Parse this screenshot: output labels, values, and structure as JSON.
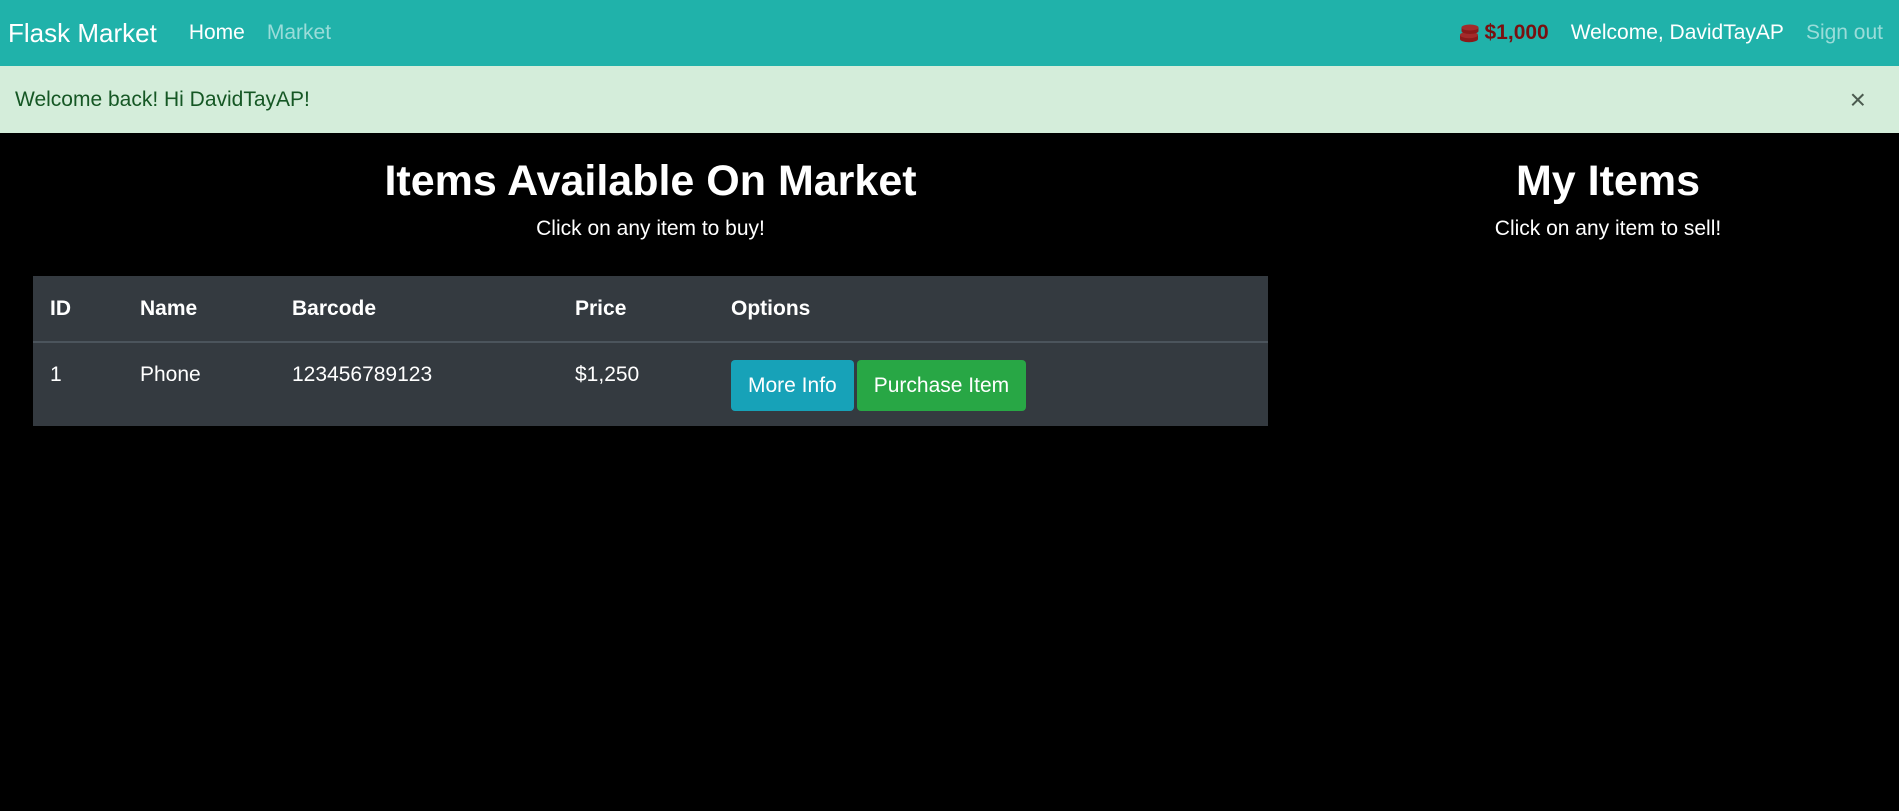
{
  "navbar": {
    "brand": "Flask Market",
    "links": [
      {
        "label": "Home"
      },
      {
        "label": "Market"
      }
    ],
    "budget": "$1,000",
    "budget_icon": "coins-icon",
    "welcome": "Welcome, DavidTayAP",
    "signout": "Sign out",
    "bg_color": "#20b2aa"
  },
  "alert": {
    "message": "Welcome back! Hi DavidTayAP!",
    "close": "×",
    "bg_color": "#d4edda"
  },
  "market": {
    "title": "Items Available On Market",
    "subtitle": "Click on any item to buy!",
    "table": {
      "headers": [
        "ID",
        "Name",
        "Barcode",
        "Price",
        "Options"
      ],
      "rows": [
        {
          "id": "1",
          "name": "Phone",
          "barcode": "123456789123",
          "price": "$1,250",
          "more_info_label": "More Info",
          "purchase_label": "Purchase Item"
        }
      ]
    }
  },
  "owned": {
    "title": "My Items",
    "subtitle": "Click on any item to sell!"
  },
  "colors": {
    "info_button": "#17a2b8",
    "success_button": "#28a745",
    "table_bg": "#343a40",
    "budget_text": "#7a0f0f"
  }
}
